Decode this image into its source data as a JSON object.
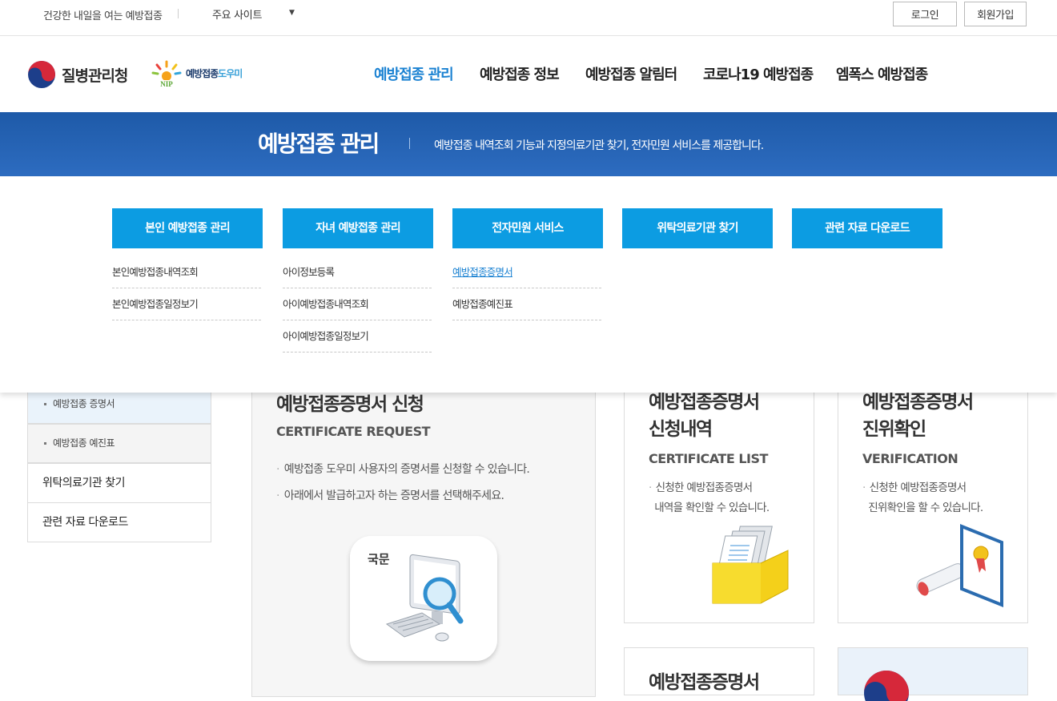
{
  "topbar": {
    "slogan": "건강한 내일을 여는 예방접종",
    "sites_label": "주요 사이트",
    "caret": "▼",
    "login_label": "로그인",
    "join_label": "회원가입"
  },
  "header": {
    "kdca_name": "질병관리청",
    "nip_name_main": "예방접종",
    "nip_name_tail": "도우미",
    "nip_badge": "NIP",
    "gnb": [
      {
        "label": "예방접종 관리",
        "active": true
      },
      {
        "label": "예방접종 정보"
      },
      {
        "label": "예방접종 알림터"
      },
      {
        "label": "코로나19 예방접종"
      },
      {
        "label": "엠폭스 예방접종"
      }
    ]
  },
  "banner": {
    "title": "예방접종 관리",
    "desc": "예방접종 내역조회 기능과 지정의료기관 찾기, 전자민원 서비스를 제공합니다."
  },
  "mega": {
    "columns": [
      {
        "head": "본인 예방접종 관리",
        "items": [
          "본인예방접종내역조회",
          "본인예방접종일정보기"
        ]
      },
      {
        "head": "자녀 예방접종 관리",
        "items": [
          "아이정보등록",
          "아이예방접종내역조회",
          "아이예방접종일정보기"
        ]
      },
      {
        "head": "전자민원 서비스",
        "items": [
          "예방접종증명서",
          "예방접종예진표"
        ],
        "active_index": 0
      },
      {
        "head": "위탁의료기관 찾기",
        "items": []
      },
      {
        "head": "관련 자료 다운로드",
        "items": []
      }
    ]
  },
  "lnb": {
    "sub_items": [
      "예방접종 증명서",
      "예방접종 예진표"
    ],
    "main_items": [
      "위탁의료기관 찾기",
      "관련 자료 다운로드"
    ]
  },
  "content": {
    "request": {
      "title": "예방접종증명서 신청",
      "en": "CERTIFICATE REQUEST",
      "bullets": [
        "예방접종 도우미 사용자의 증명서를 신청할 수 있습니다.",
        "아래에서 발급하고자 하는 증명서를 선택해주세요."
      ],
      "tile_label": "국문"
    },
    "list": {
      "title_line1": "예방접종증명서",
      "title_line2": "신청내역",
      "en": "CERTIFICATE LIST",
      "desc_line1": "신청한 예방접종증명서",
      "desc_line2": "내역을 확인할 수 있습니다."
    },
    "verify": {
      "title_line1": "예방접종증명서",
      "title_line2": "진위확인",
      "en": "VERIFICATION",
      "desc_line1": "신청한 예방접종증명서",
      "desc_line2": "진위확인을 할 수 있습니다."
    },
    "card3_title": "예방접종증명서"
  },
  "colors": {
    "accent": "#1b82d2",
    "menu_head": "#0c9ce2",
    "banner_top": "#1e5aa8",
    "banner_bottom": "#2d6cc0"
  }
}
